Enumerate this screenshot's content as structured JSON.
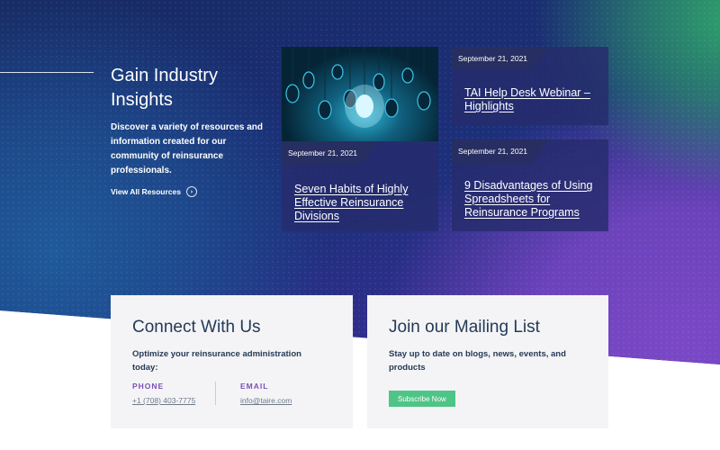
{
  "intro": {
    "title": "Gain Industry Insights",
    "description": "Discover a variety of resources and information created for our community of reinsurance professionals.",
    "view_all_label": "View All Resources"
  },
  "resources": [
    {
      "date": "September 21, 2021",
      "title": "Seven Habits of Highly Effective Reinsurance Divisions",
      "image_icon": "lightbulbs-image"
    },
    {
      "date": "September 21, 2021",
      "title": "TAI Help Desk Webinar – Highlights"
    },
    {
      "date": "September 21, 2021",
      "title": "9 Disadvantages of Using Spreadsheets for Reinsurance Programs"
    }
  ],
  "connect": {
    "title": "Connect With Us",
    "subtitle": "Optimize your reinsurance administration today:",
    "phone_label": "PHONE",
    "phone_value": "+1 (708) 403-7775",
    "email_label": "EMAIL",
    "email_value": "info@taire.com"
  },
  "mailing": {
    "title": "Join our Mailing List",
    "subtitle": "Stay up to date on blogs, news, events, and products",
    "button_label": "Subscribe Now"
  },
  "colors": {
    "accent_green": "#4fc487",
    "accent_purple": "#7d4fb6",
    "heading_navy": "#243a55"
  }
}
